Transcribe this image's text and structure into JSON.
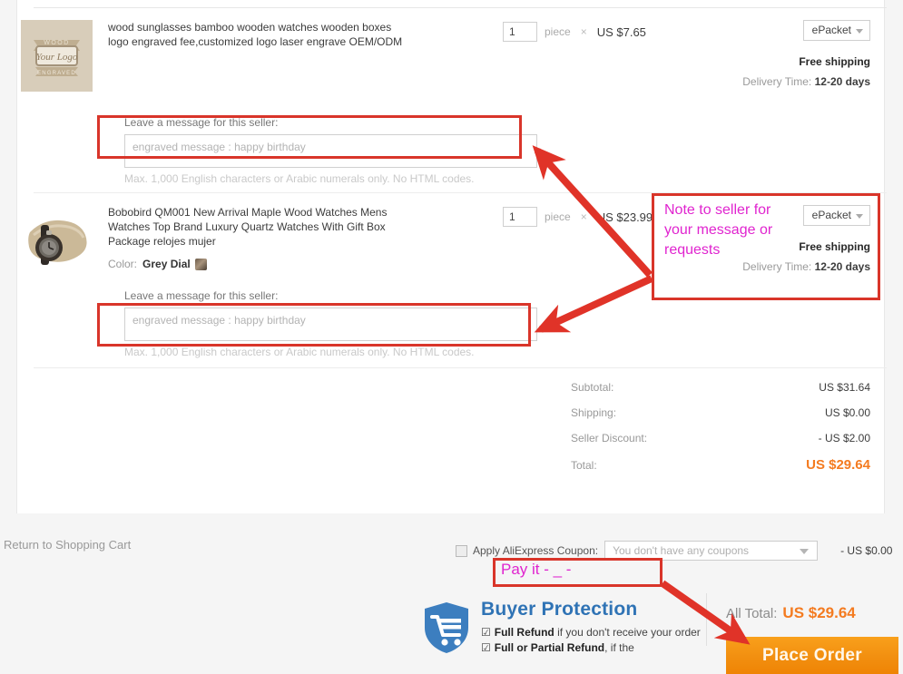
{
  "page": {
    "return_link": "Return to Shopping Cart"
  },
  "products": [
    {
      "title": "wood sunglasses bamboo wooden watches wooden boxes logo engraved fee,customized logo laser engrave OEM/ODM",
      "thumb_name": "wood-logo-engraved-thumbnail",
      "thumb_text_top": "WOOD",
      "thumb_text_mid": "Your Logo",
      "thumb_text_bottom": "ENGRAVED",
      "quantity": "1",
      "unit": "piece",
      "multiply": "×",
      "price": "US $7.65",
      "shipping_method": "ePacket",
      "shipping_cost_label": "Free shipping",
      "delivery_label": "Delivery Time:",
      "delivery_value": "12-20 days",
      "message_label": "Leave a message for this seller:",
      "message_placeholder": "engraved message : happy birthday",
      "message_value": "",
      "message_hint": "Max. 1,000 English characters or Arabic numerals only. No HTML codes."
    },
    {
      "title": "Bobobird QM001 New Arrival Maple Wood Watches Mens Watches Top Brand Luxury Quartz Watches With Gift Box Package relojes mujer",
      "thumb_name": "wood-watch-on-pillow-thumbnail",
      "attr_label": "Color:",
      "attr_value": "Grey Dial",
      "quantity": "1",
      "unit": "piece",
      "multiply": "×",
      "price": "US $23.99",
      "shipping_method": "ePacket",
      "shipping_cost_label": "Free shipping",
      "delivery_label": "Delivery Time:",
      "delivery_value": "12-20 days",
      "message_label": "Leave a message for this seller:",
      "message_placeholder": "engraved message : happy birthday",
      "message_value": "",
      "message_hint": "Max. 1,000 English characters or Arabic numerals only. No HTML codes."
    }
  ],
  "summary": {
    "subtotal_label": "Subtotal:",
    "subtotal_value": "US $31.64",
    "shipping_label": "Shipping:",
    "shipping_value": "US $0.00",
    "discount_label": "Seller Discount:",
    "discount_value": "- US $2.00",
    "total_label": "Total:",
    "total_value": "US $29.64"
  },
  "coupon": {
    "checkbox_checked": false,
    "label": "Apply AliExpress Coupon:",
    "select_placeholder": "You don't have any coupons",
    "amount": "- US $0.00"
  },
  "buyer_protection": {
    "title": "Buyer Protection",
    "items": [
      {
        "tick": "☑",
        "strong": "Full Refund",
        "rest": " if you don't receive your order"
      },
      {
        "tick": "☑",
        "strong": "Full or Partial Refund",
        "rest": ", if the"
      }
    ]
  },
  "checkout": {
    "all_total_label": "All Total:",
    "all_total_value": "US $29.64",
    "place_order_label": "Place Order"
  },
  "annotations": {
    "note_text": "Note to seller for your message or requests",
    "pay_it_text": "Pay it - _ -",
    "highlight_color": "#d9352a",
    "text_color": "#e024cf"
  },
  "colors": {
    "accent_orange": "#f47b20",
    "protection_blue": "#2f73b5",
    "annotation_red": "#d9352a",
    "annotation_magenta": "#e024cf"
  }
}
